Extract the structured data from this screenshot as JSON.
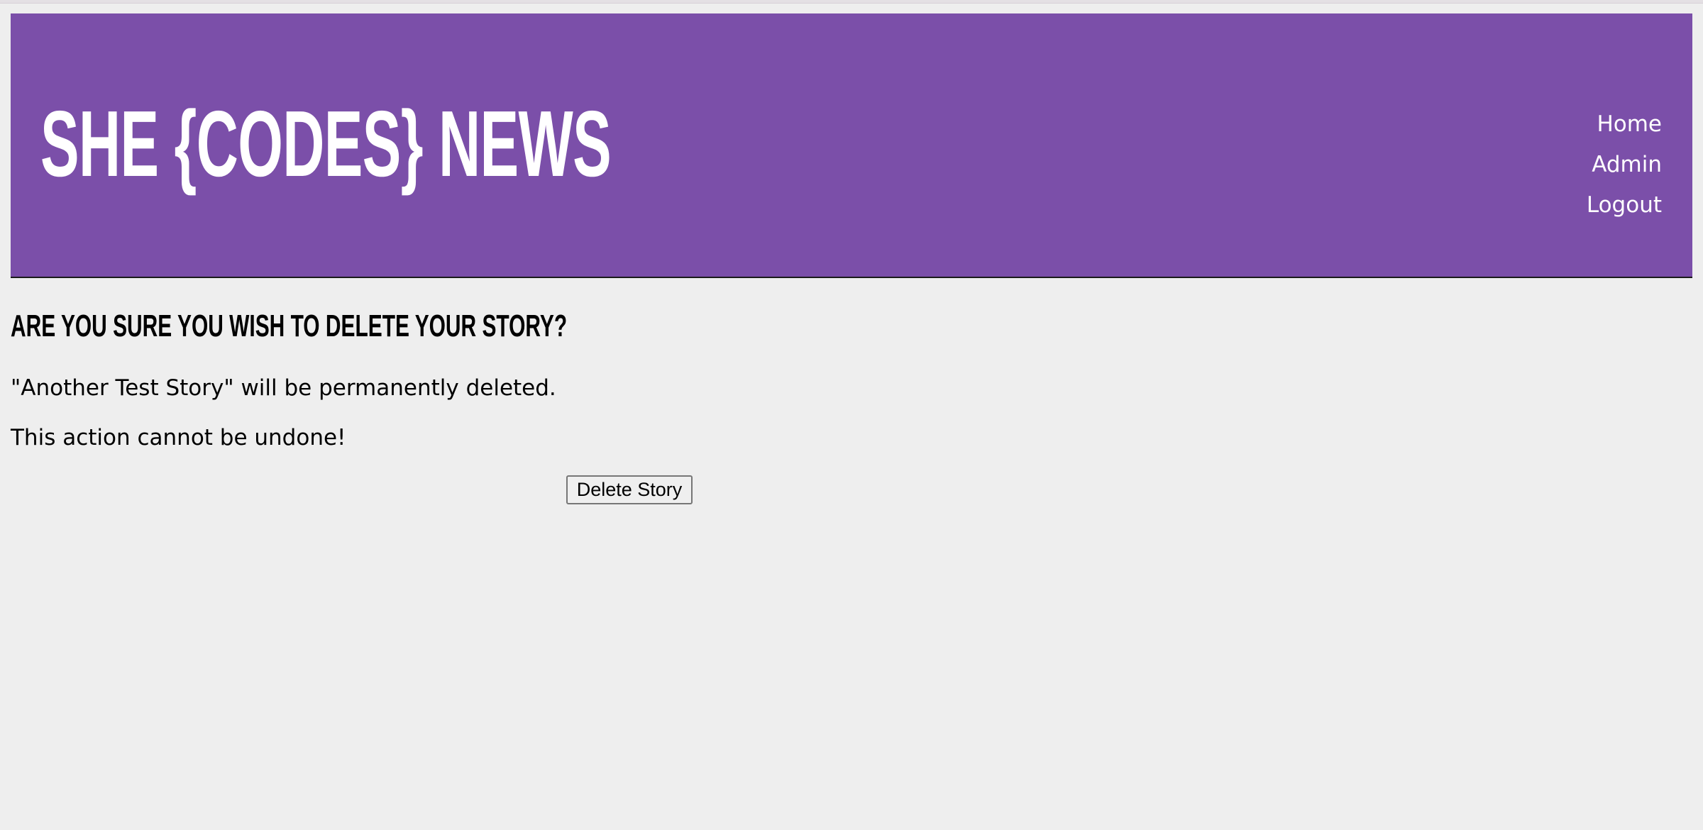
{
  "header": {
    "site_title": "SHE {CODES} NEWS",
    "background_color": "#7b4fa9",
    "nav": [
      {
        "label": "Home"
      },
      {
        "label": "Admin"
      },
      {
        "label": "Logout"
      }
    ]
  },
  "main": {
    "heading": "Are you sure you wish to delete your story?",
    "message": "\"Another Test Story\" will be permanently deleted.",
    "warning": "This action cannot be undone!",
    "delete_button_label": "Delete Story"
  }
}
